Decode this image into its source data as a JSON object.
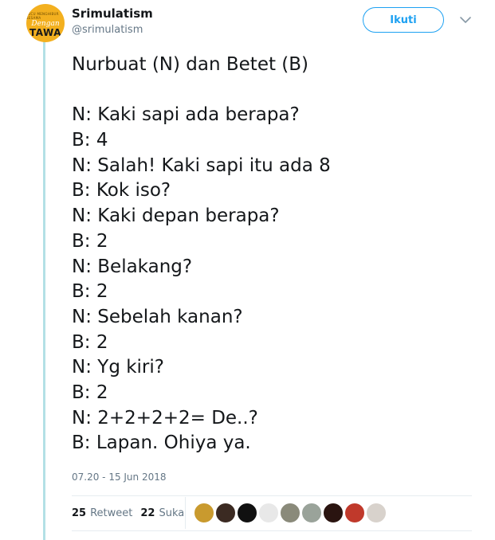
{
  "user": {
    "name": "Srimulatism",
    "handle": "@srimulatism",
    "avatar_text": {
      "small": "LUCU MENGHIBUR SESAMA",
      "middle": "Dengan",
      "bottom": "TAWA"
    }
  },
  "follow_label": "Ikuti",
  "tweet_lines": [
    "Nurbuat (N) dan Betet (B)",
    "",
    "N: Kaki sapi ada berapa?",
    "B: 4",
    "N: Salah! Kaki sapi itu ada 8",
    "B: Kok iso?",
    "N: Kaki depan berapa?",
    "B: 2",
    "N: Belakang?",
    "B: 2",
    "N: Sebelah kanan?",
    "B: 2",
    "N: Yg kiri?",
    "B: 2",
    "N: 2+2+2+2= De..?",
    "B: Lapan. Ohiya ya."
  ],
  "timestamp": "07.20 - 15 Jun 2018",
  "stats": {
    "retweets": "25",
    "retweets_label": "Retweet",
    "likes": "22",
    "likes_label": "Suka"
  },
  "likers": [
    {
      "color": "#c99a2e"
    },
    {
      "color": "#3b2a22"
    },
    {
      "color": "#111111"
    },
    {
      "color": "#e8e8e8"
    },
    {
      "color": "#8a8a7a"
    },
    {
      "color": "#9aa39a"
    },
    {
      "color": "#2a1410"
    },
    {
      "color": "#c0392b"
    },
    {
      "color": "#d8d2cc"
    }
  ],
  "colors": {
    "accent": "#1da1f2",
    "thread_line": "#b3e0e6",
    "muted": "#657786"
  }
}
